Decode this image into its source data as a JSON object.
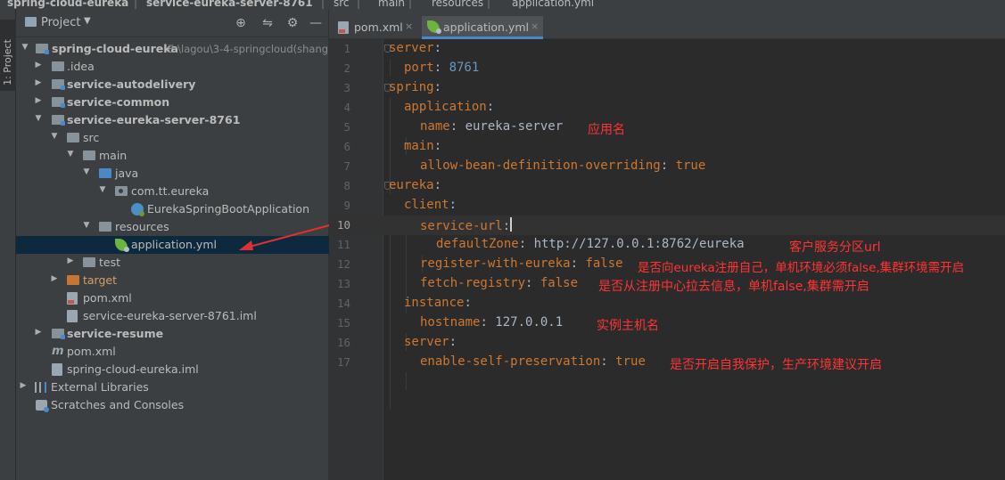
{
  "breadcrumb": [
    {
      "label": "spring-cloud-eureka"
    },
    {
      "label": "service-eureka-server-8761"
    },
    {
      "label": "src"
    },
    {
      "label": "main"
    },
    {
      "label": "resources"
    },
    {
      "label": "application.yml"
    }
  ],
  "strip": {
    "label": "1: Project"
  },
  "panel": {
    "title": "Project"
  },
  "tree": [
    {
      "label": "spring-cloud-eureka",
      "path": "E:\\lagou\\3-4-springcloud(shang"
    },
    {
      "label": ".idea"
    },
    {
      "label": "service-autodelivery"
    },
    {
      "label": "service-common"
    },
    {
      "label": "service-eureka-server-8761"
    },
    {
      "label": "src"
    },
    {
      "label": "main"
    },
    {
      "label": "java"
    },
    {
      "label": "com.tt.eureka"
    },
    {
      "label": "EurekaSpringBootApplication"
    },
    {
      "label": "resources"
    },
    {
      "label": "application.yml"
    },
    {
      "label": "test"
    },
    {
      "label": "target"
    },
    {
      "label": "pom.xml"
    },
    {
      "label": "service-eureka-server-8761.iml"
    },
    {
      "label": "service-resume"
    },
    {
      "label": "pom.xml"
    },
    {
      "label": "spring-cloud-eureka.iml"
    },
    {
      "label": "External Libraries"
    },
    {
      "label": "Scratches and Consoles"
    }
  ],
  "tabs": [
    {
      "label": "pom.xml",
      "close": "×"
    },
    {
      "label": "application.yml",
      "close": "×"
    }
  ],
  "code": [
    {
      "num": "1",
      "key": "server",
      "sep": ":",
      "val": ""
    },
    {
      "num": "2",
      "key": "port",
      "sep": ": ",
      "val": "8761"
    },
    {
      "num": "3",
      "key": "spring",
      "sep": ":",
      "val": ""
    },
    {
      "num": "4",
      "key": "application",
      "sep": ":",
      "val": ""
    },
    {
      "num": "5",
      "key": "name",
      "sep": ": ",
      "val": "eureka-server"
    },
    {
      "num": "6",
      "key": "main",
      "sep": ":",
      "val": ""
    },
    {
      "num": "7",
      "key": "allow-bean-definition-overriding",
      "sep": ": ",
      "val": "true"
    },
    {
      "num": "8",
      "key": "eureka",
      "sep": ":",
      "val": ""
    },
    {
      "num": "9",
      "key": "client",
      "sep": ":",
      "val": ""
    },
    {
      "num": "10",
      "key": "service-url",
      "sep": ":",
      "val": ""
    },
    {
      "num": "11",
      "key": "defaultZone",
      "sep": ": ",
      "val": "http://127.0.0.1:8762/eureka"
    },
    {
      "num": "12",
      "key": "register-with-eureka",
      "sep": ": ",
      "val": "false"
    },
    {
      "num": "13",
      "key": "fetch-registry",
      "sep": ": ",
      "val": "false"
    },
    {
      "num": "14",
      "key": "instance",
      "sep": ":",
      "val": ""
    },
    {
      "num": "15",
      "key": "hostname",
      "sep": ": ",
      "val": "127.0.0.1"
    },
    {
      "num": "16",
      "key": "server",
      "sep": ":",
      "val": ""
    },
    {
      "num": "17",
      "key": "enable-self-preservation",
      "sep": ": ",
      "val": "true"
    }
  ],
  "notes": {
    "line5": "应用名",
    "line11": "客户服务分区url",
    "line12": "是否向eureka注册自己，单机环境必须false,集群环境需开启",
    "line13": "是否从注册中心拉去信息，单机false,集群需开启",
    "line15": "实例主机名",
    "line17": "是否开启自我保护，生产环境建议开启"
  },
  "colors": {
    "yaml_key": "#cc7832",
    "yaml_value": "#a9b7c6",
    "number": "#6897bb",
    "annotation": "#ff3333",
    "selection": "#0d293e"
  }
}
